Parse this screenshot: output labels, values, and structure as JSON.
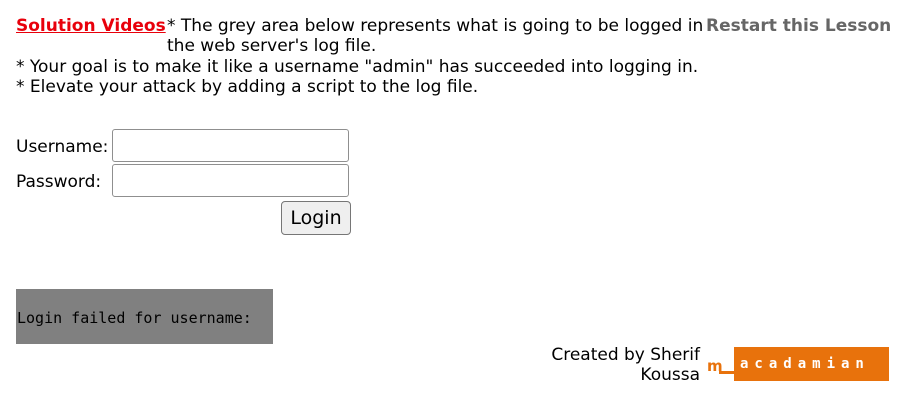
{
  "header": {
    "solution_link": "Solution Videos",
    "intro": "* The grey area below represents what is going to be logged in the web server's log file.",
    "restart_link": "Restart this Lesson",
    "goals": [
      "* Your goal is to make it like a username \"admin\" has succeeded into logging in.",
      "* Elevate your attack by adding a script to the log file."
    ]
  },
  "form": {
    "username_label": "Username:",
    "username_value": "",
    "password_label": "Password:",
    "password_value": "",
    "login_button": "Login"
  },
  "log": {
    "text": "Login failed for username:",
    "background": "#808080"
  },
  "footer": {
    "credit": "Created by Sherif Koussa",
    "logo_text": "macadamian",
    "logo_letters": "acadamian",
    "logo_color": "#e8720c"
  },
  "colors": {
    "solution_link": "#e8000b",
    "restart_link": "#666666"
  }
}
